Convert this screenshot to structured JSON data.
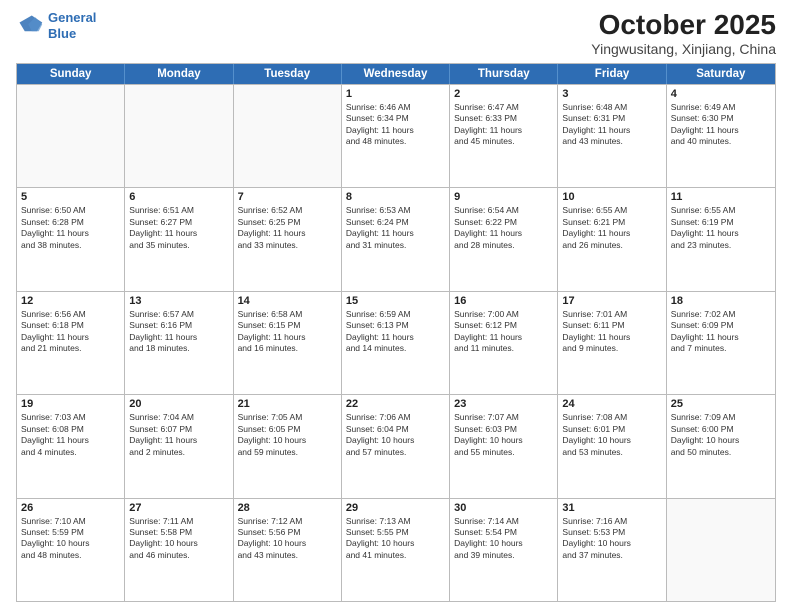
{
  "header": {
    "logo_line1": "General",
    "logo_line2": "Blue",
    "month": "October 2025",
    "location": "Yingwusitang, Xinjiang, China"
  },
  "days_of_week": [
    "Sunday",
    "Monday",
    "Tuesday",
    "Wednesday",
    "Thursday",
    "Friday",
    "Saturday"
  ],
  "weeks": [
    [
      {
        "day": "",
        "text": ""
      },
      {
        "day": "",
        "text": ""
      },
      {
        "day": "",
        "text": ""
      },
      {
        "day": "1",
        "text": "Sunrise: 6:46 AM\nSunset: 6:34 PM\nDaylight: 11 hours\nand 48 minutes."
      },
      {
        "day": "2",
        "text": "Sunrise: 6:47 AM\nSunset: 6:33 PM\nDaylight: 11 hours\nand 45 minutes."
      },
      {
        "day": "3",
        "text": "Sunrise: 6:48 AM\nSunset: 6:31 PM\nDaylight: 11 hours\nand 43 minutes."
      },
      {
        "day": "4",
        "text": "Sunrise: 6:49 AM\nSunset: 6:30 PM\nDaylight: 11 hours\nand 40 minutes."
      }
    ],
    [
      {
        "day": "5",
        "text": "Sunrise: 6:50 AM\nSunset: 6:28 PM\nDaylight: 11 hours\nand 38 minutes."
      },
      {
        "day": "6",
        "text": "Sunrise: 6:51 AM\nSunset: 6:27 PM\nDaylight: 11 hours\nand 35 minutes."
      },
      {
        "day": "7",
        "text": "Sunrise: 6:52 AM\nSunset: 6:25 PM\nDaylight: 11 hours\nand 33 minutes."
      },
      {
        "day": "8",
        "text": "Sunrise: 6:53 AM\nSunset: 6:24 PM\nDaylight: 11 hours\nand 31 minutes."
      },
      {
        "day": "9",
        "text": "Sunrise: 6:54 AM\nSunset: 6:22 PM\nDaylight: 11 hours\nand 28 minutes."
      },
      {
        "day": "10",
        "text": "Sunrise: 6:55 AM\nSunset: 6:21 PM\nDaylight: 11 hours\nand 26 minutes."
      },
      {
        "day": "11",
        "text": "Sunrise: 6:55 AM\nSunset: 6:19 PM\nDaylight: 11 hours\nand 23 minutes."
      }
    ],
    [
      {
        "day": "12",
        "text": "Sunrise: 6:56 AM\nSunset: 6:18 PM\nDaylight: 11 hours\nand 21 minutes."
      },
      {
        "day": "13",
        "text": "Sunrise: 6:57 AM\nSunset: 6:16 PM\nDaylight: 11 hours\nand 18 minutes."
      },
      {
        "day": "14",
        "text": "Sunrise: 6:58 AM\nSunset: 6:15 PM\nDaylight: 11 hours\nand 16 minutes."
      },
      {
        "day": "15",
        "text": "Sunrise: 6:59 AM\nSunset: 6:13 PM\nDaylight: 11 hours\nand 14 minutes."
      },
      {
        "day": "16",
        "text": "Sunrise: 7:00 AM\nSunset: 6:12 PM\nDaylight: 11 hours\nand 11 minutes."
      },
      {
        "day": "17",
        "text": "Sunrise: 7:01 AM\nSunset: 6:11 PM\nDaylight: 11 hours\nand 9 minutes."
      },
      {
        "day": "18",
        "text": "Sunrise: 7:02 AM\nSunset: 6:09 PM\nDaylight: 11 hours\nand 7 minutes."
      }
    ],
    [
      {
        "day": "19",
        "text": "Sunrise: 7:03 AM\nSunset: 6:08 PM\nDaylight: 11 hours\nand 4 minutes."
      },
      {
        "day": "20",
        "text": "Sunrise: 7:04 AM\nSunset: 6:07 PM\nDaylight: 11 hours\nand 2 minutes."
      },
      {
        "day": "21",
        "text": "Sunrise: 7:05 AM\nSunset: 6:05 PM\nDaylight: 10 hours\nand 59 minutes."
      },
      {
        "day": "22",
        "text": "Sunrise: 7:06 AM\nSunset: 6:04 PM\nDaylight: 10 hours\nand 57 minutes."
      },
      {
        "day": "23",
        "text": "Sunrise: 7:07 AM\nSunset: 6:03 PM\nDaylight: 10 hours\nand 55 minutes."
      },
      {
        "day": "24",
        "text": "Sunrise: 7:08 AM\nSunset: 6:01 PM\nDaylight: 10 hours\nand 53 minutes."
      },
      {
        "day": "25",
        "text": "Sunrise: 7:09 AM\nSunset: 6:00 PM\nDaylight: 10 hours\nand 50 minutes."
      }
    ],
    [
      {
        "day": "26",
        "text": "Sunrise: 7:10 AM\nSunset: 5:59 PM\nDaylight: 10 hours\nand 48 minutes."
      },
      {
        "day": "27",
        "text": "Sunrise: 7:11 AM\nSunset: 5:58 PM\nDaylight: 10 hours\nand 46 minutes."
      },
      {
        "day": "28",
        "text": "Sunrise: 7:12 AM\nSunset: 5:56 PM\nDaylight: 10 hours\nand 43 minutes."
      },
      {
        "day": "29",
        "text": "Sunrise: 7:13 AM\nSunset: 5:55 PM\nDaylight: 10 hours\nand 41 minutes."
      },
      {
        "day": "30",
        "text": "Sunrise: 7:14 AM\nSunset: 5:54 PM\nDaylight: 10 hours\nand 39 minutes."
      },
      {
        "day": "31",
        "text": "Sunrise: 7:16 AM\nSunset: 5:53 PM\nDaylight: 10 hours\nand 37 minutes."
      },
      {
        "day": "",
        "text": ""
      }
    ]
  ]
}
